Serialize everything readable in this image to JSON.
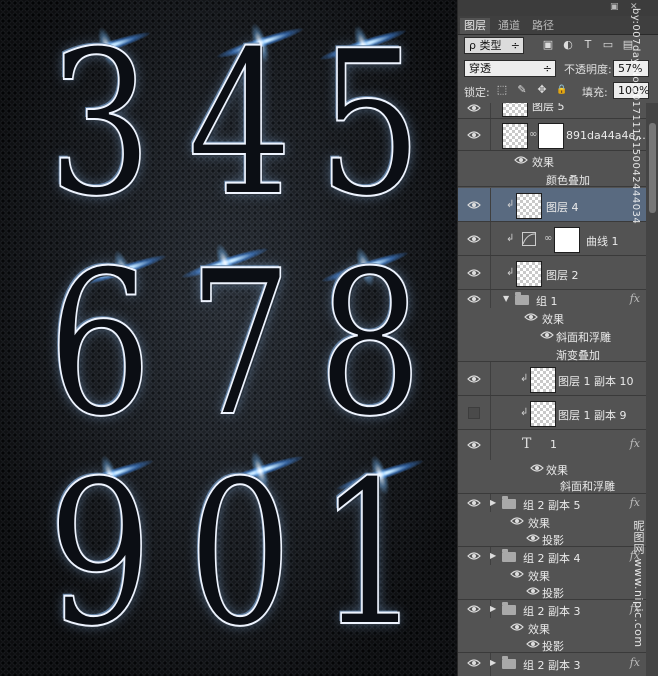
{
  "canvas": {
    "digits": [
      "3",
      "4",
      "5",
      "6",
      "7",
      "8",
      "9",
      "0",
      "1"
    ]
  },
  "panel": {
    "tabs": [
      "图层",
      "通道",
      "路径"
    ],
    "active_tab": 0,
    "filter": {
      "label": "ρ 类型",
      "arrow": "÷"
    },
    "filter_icons": [
      "image-filter-icon",
      "adjustment-filter-icon",
      "type-filter-icon",
      "shape-filter-icon",
      "smart-object-filter-icon"
    ],
    "filter_glyphs": [
      "▣",
      "◐",
      "T",
      "▭",
      "▤"
    ],
    "blend_mode": "穿透",
    "opacity_label": "不透明度:",
    "opacity_value": "57%",
    "lock_label": "锁定:",
    "fill_label": "填充:",
    "fill_value": "100%",
    "lock_glyphs": [
      "⬚",
      "✎",
      "✥",
      "🔒"
    ],
    "rows": {
      "partial": "图层 5",
      "smart": "891da44a4e...",
      "smart_effects": "效果",
      "smart_color_overlay": "颜色叠加",
      "layer4": "图层 4",
      "curves": "曲线 1",
      "layer2": "图层 2",
      "group1": "组 1",
      "group1_effects": "效果",
      "group1_bevel": "斜面和浮雕",
      "group1_gradient": "渐变叠加",
      "copy10": "图层 1 副本 10",
      "copy9": "图层 1 副本 9",
      "type_layer": "1",
      "type_effects": "效果",
      "type_bevel": "斜面和浮雕",
      "g2c5": "组 2 副本 5",
      "g2c5_effects": "效果",
      "g2c5_shadow": "投影",
      "g2c4": "组 2 副本 4",
      "g2c4_effects": "效果",
      "g2c4_shadow": "投影",
      "g2c3a": "组 2 副本 3",
      "g2c3a_effects": "效果",
      "g2c3a_shadow": "投影",
      "g2c3b": "组 2 副本 3"
    },
    "fx_symbol": "fx",
    "type_glyph": "T",
    "watermark_id": "by:007day No:20171115150042444034",
    "watermark_site": "昵图网 www.nipic.com"
  },
  "colors": {
    "panel_bg": "#535353",
    "selected_row": "#596a80",
    "canvas_bg": "#1b1d21",
    "flare": "#4da6ff"
  }
}
